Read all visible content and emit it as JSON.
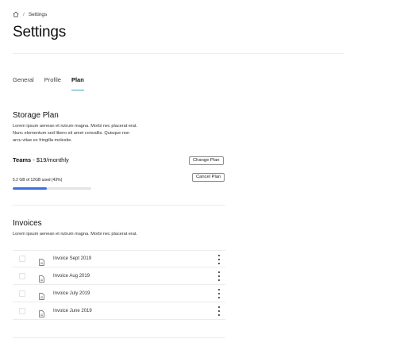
{
  "breadcrumb": {
    "home_icon": "home-icon",
    "separator": "/",
    "current": "Settings"
  },
  "page": {
    "title": "Settings"
  },
  "tabs": [
    {
      "label": "General",
      "active": false
    },
    {
      "label": "Profile",
      "active": false
    },
    {
      "label": "Plan",
      "active": true
    }
  ],
  "storage": {
    "title": "Storage Plan",
    "description_lines": [
      "Lorem ipsum aenean et rutrum magna. Morbi nec placerat erat.",
      "Nunc elementum sed libero sit amet convallis. Quisque non",
      "arcu vitae ex fringilla molestie."
    ],
    "plan_name": "Teams",
    "plan_price": " - $19/monthly",
    "change_plan_label": "Change Plan",
    "cancel_plan_label": "Cancel Plan",
    "usage_text": "5.2 GB of 12GB used (43%)",
    "usage_fraction": 0.43,
    "progress_color": "#3b6fe0"
  },
  "invoices": {
    "title": "Invoices",
    "description": "Lorem ipsum aenean et rutrum magna. Morbi nec placerat erat.",
    "items": [
      {
        "label": "Invoice Sept 2019",
        "icon": "document-icon"
      },
      {
        "label": "Invoice Aug 2019",
        "icon": "document-icon"
      },
      {
        "label": "Invoice July 2019",
        "icon": "document-icon"
      },
      {
        "label": "Invoice June 2019",
        "icon": "document-icon"
      }
    ]
  },
  "colors": {
    "accent": "#3aa3c9",
    "progress": "#3b6fe0"
  }
}
